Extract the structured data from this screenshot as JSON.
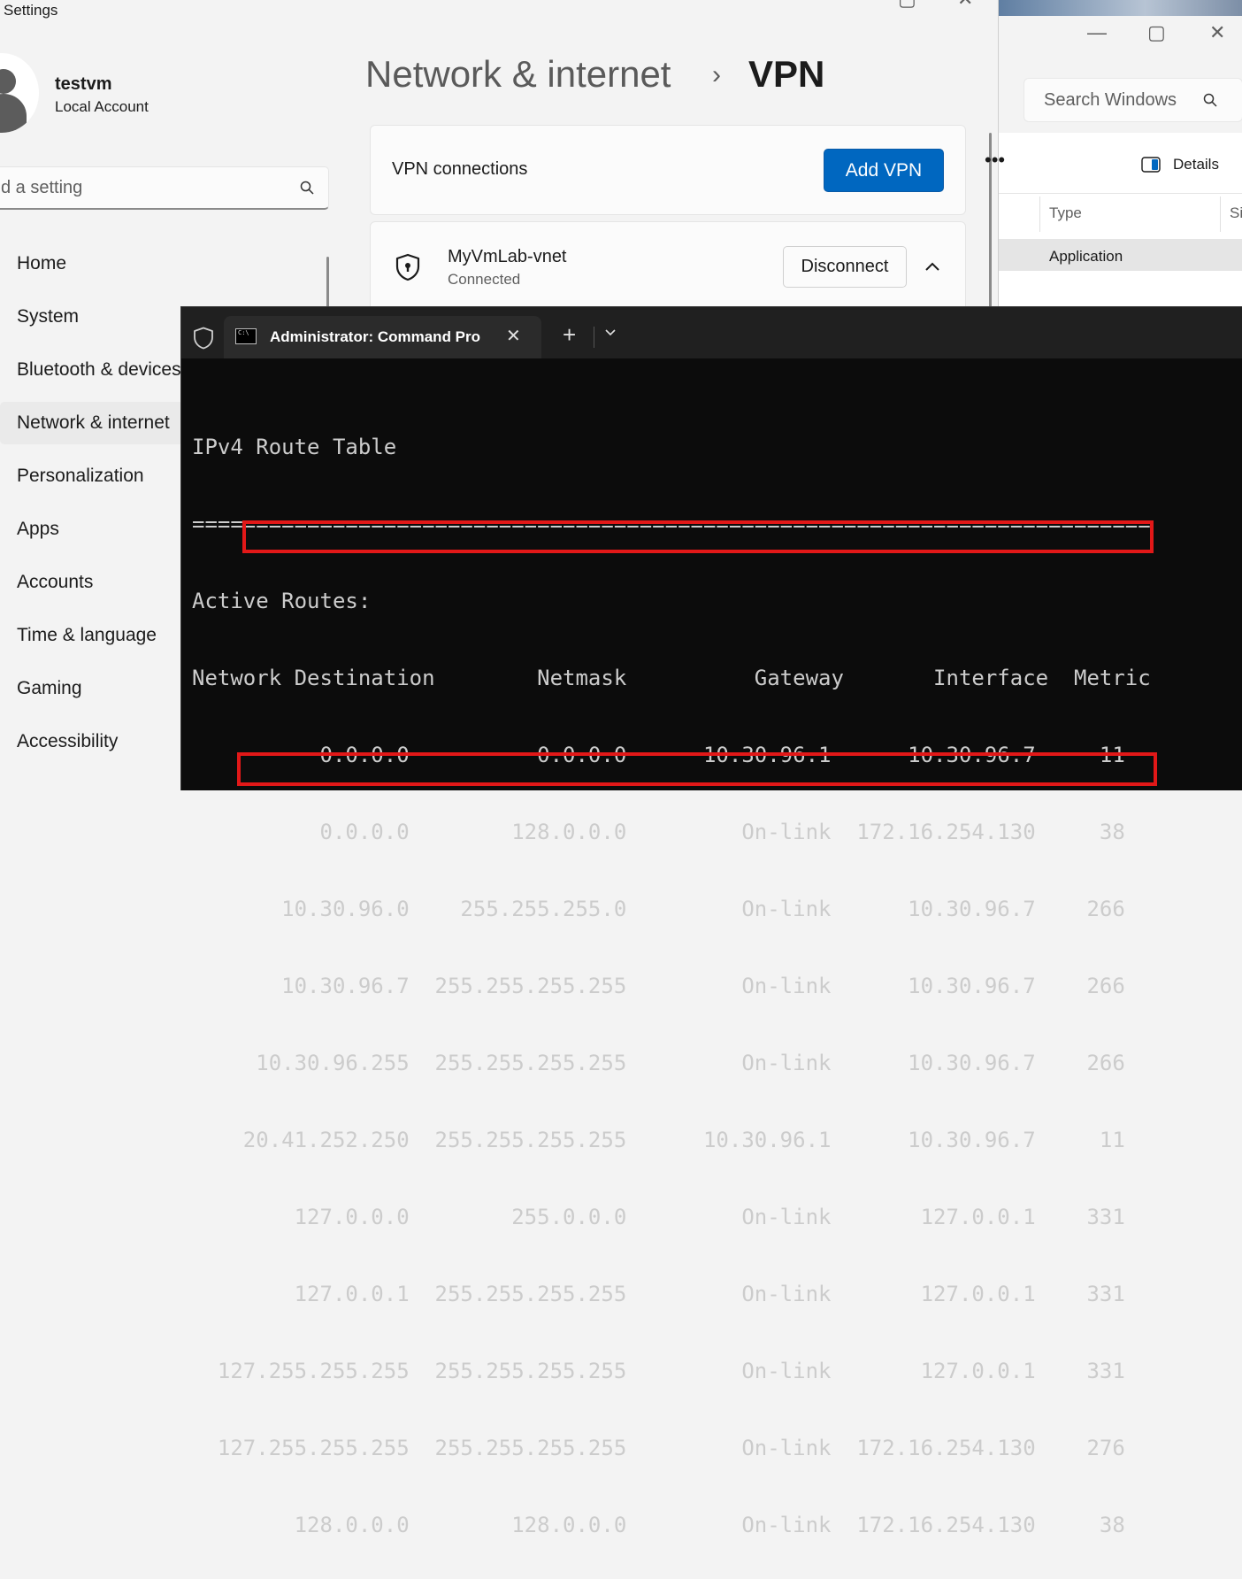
{
  "settings": {
    "window_title": "Settings",
    "user": {
      "name": "testvm",
      "account_type": "Local Account"
    },
    "search_placeholder": "d a setting",
    "nav": [
      {
        "label": "Home"
      },
      {
        "label": "System"
      },
      {
        "label": "Bluetooth & devices"
      },
      {
        "label": "Network & internet",
        "active": true
      },
      {
        "label": "Personalization"
      },
      {
        "label": "Apps"
      },
      {
        "label": "Accounts"
      },
      {
        "label": "Time & language"
      },
      {
        "label": "Gaming"
      },
      {
        "label": "Accessibility"
      }
    ],
    "breadcrumb": {
      "parent": "Network & internet",
      "separator": "›",
      "current": "VPN"
    },
    "vpn_connections_label": "VPN connections",
    "add_vpn_label": "Add VPN",
    "connection": {
      "name": "MyVmLab-vnet",
      "status": "Connected",
      "disconnect_label": "Disconnect"
    }
  },
  "explorer": {
    "search_placeholder": "Search Windows",
    "more_label": "•••",
    "details_label": "Details",
    "columns": {
      "type": "Type",
      "size": "Si"
    },
    "row_type": "Application"
  },
  "terminal": {
    "tab_title": "Administrator: Command Pro",
    "lines": [
      "IPv4 Route Table",
      "===========================================================================",
      "Active Routes:",
      "Network Destination        Netmask          Gateway       Interface  Metric",
      "          0.0.0.0          0.0.0.0      10.30.96.1      10.30.96.7     11",
      "          0.0.0.0        128.0.0.0         On-link  172.16.254.130     38",
      "       10.30.96.0    255.255.255.0         On-link      10.30.96.7    266",
      "       10.30.96.7  255.255.255.255         On-link      10.30.96.7    266",
      "     10.30.96.255  255.255.255.255         On-link      10.30.96.7    266",
      "    20.41.252.250  255.255.255.255      10.30.96.1      10.30.96.7     11",
      "        127.0.0.0        255.0.0.0         On-link       127.0.0.1    331",
      "        127.0.0.1  255.255.255.255         On-link       127.0.0.1    331",
      "  127.255.255.255  255.255.255.255         On-link       127.0.0.1    331",
      "  127.255.255.255  255.255.255.255         On-link  172.16.254.130    276",
      "        128.0.0.0        128.0.0.0         On-link  172.16.254.130     38"
    ]
  },
  "colors": {
    "accent": "#0067c0",
    "highlight": "#e21818",
    "terminal_bg": "#0c0c0c"
  }
}
